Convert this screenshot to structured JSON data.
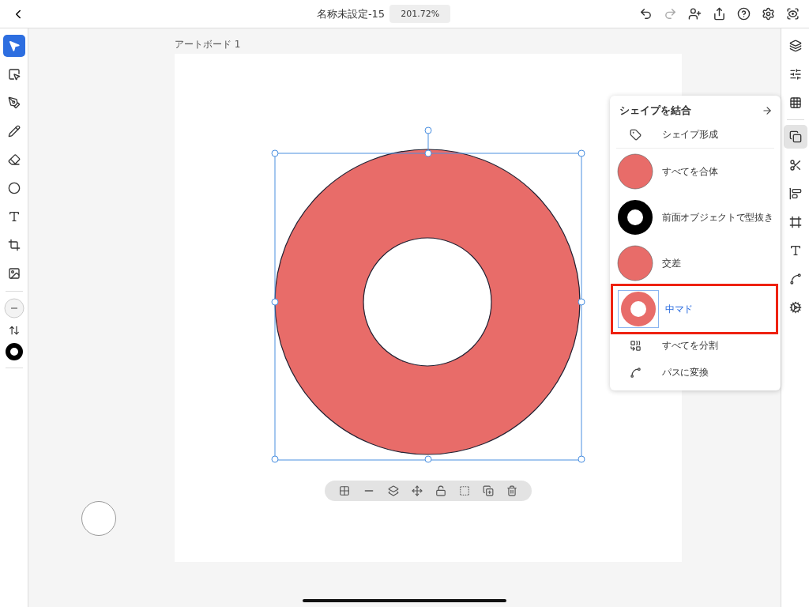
{
  "document": {
    "title": "名称未設定-15",
    "zoom": "201.72%"
  },
  "tools": [
    {
      "kind": "select",
      "selected": true
    },
    {
      "kind": "direct",
      "selected": false
    },
    {
      "kind": "pen",
      "selected": false
    },
    {
      "kind": "pencil",
      "selected": false
    },
    {
      "kind": "eraser",
      "selected": false
    },
    {
      "kind": "ellipse",
      "selected": false
    },
    {
      "kind": "text",
      "selected": false
    },
    {
      "kind": "crop",
      "selected": false
    },
    {
      "kind": "image",
      "selected": false
    }
  ],
  "rail": [
    {
      "kind": "layers",
      "selected": false
    },
    {
      "kind": "properties",
      "selected": false
    },
    {
      "kind": "grid",
      "selected": false
    },
    {
      "kind": "combine",
      "selected": true
    },
    {
      "kind": "scissors",
      "selected": false
    },
    {
      "kind": "align",
      "selected": false
    },
    {
      "kind": "frame",
      "selected": false
    },
    {
      "kind": "type",
      "selected": false
    },
    {
      "kind": "path",
      "selected": false
    },
    {
      "kind": "repeat",
      "selected": false
    }
  ],
  "artboard": {
    "label": "アートボード 1"
  },
  "panel": {
    "title": "シェイプを結合",
    "items": [
      {
        "kind": "builder",
        "label": "シェイプ形成",
        "selected": false
      },
      {
        "kind": "unite",
        "label": "すべてを合体",
        "selected": false
      },
      {
        "kind": "minus",
        "label": "前面オブジェクトで型抜き",
        "selected": false
      },
      {
        "kind": "intersect",
        "label": "交差",
        "selected": false
      },
      {
        "kind": "exclude",
        "label": "中マド",
        "selected": true
      },
      {
        "kind": "divide",
        "label": "すべてを分割",
        "selected": false
      },
      {
        "kind": "outline",
        "label": "パスに変換",
        "selected": false
      }
    ]
  }
}
